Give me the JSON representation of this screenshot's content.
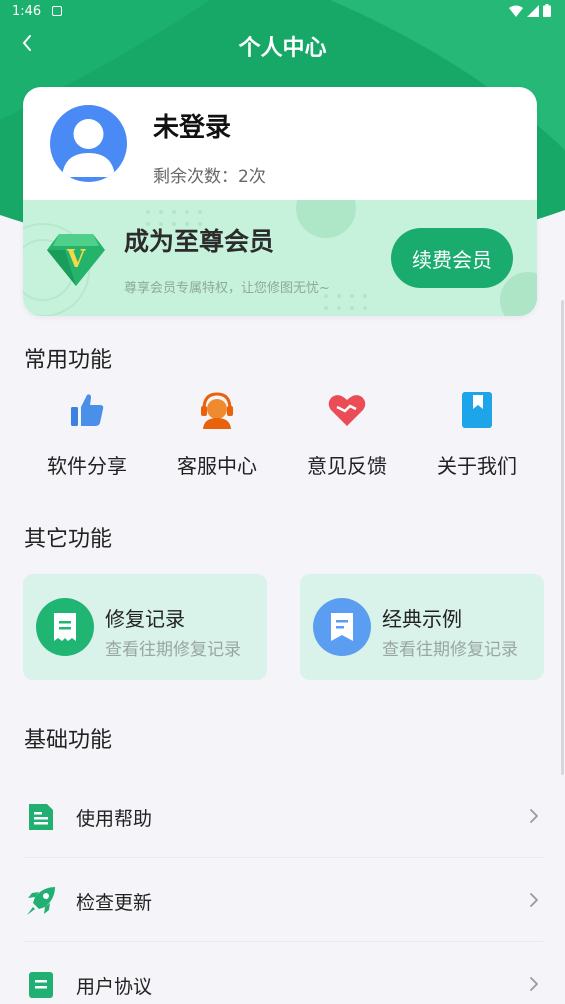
{
  "status_bar": {
    "time": "1:46"
  },
  "header": {
    "title": "个人中心"
  },
  "profile": {
    "name": "未登录",
    "remaining_label": "剩余次数：",
    "remaining_count": "2次"
  },
  "vip": {
    "title": "成为至尊会员",
    "subtitle": "尊享会员专属特权，让您修图无忧~",
    "button": "续费会员"
  },
  "sections": {
    "common": "常用功能",
    "other": "其它功能",
    "basic": "基础功能"
  },
  "common_functions": [
    {
      "label": "软件分享",
      "icon": "thumbs-up-icon"
    },
    {
      "label": "客服中心",
      "icon": "customer-service-icon"
    },
    {
      "label": "意见反馈",
      "icon": "heart-icon"
    },
    {
      "label": "关于我们",
      "icon": "book-icon"
    }
  ],
  "other_functions": [
    {
      "title": "修复记录",
      "subtitle": "查看往期修复记录",
      "icon": "receipt-icon"
    },
    {
      "title": "经典示例",
      "subtitle": "查看往期修复记录",
      "icon": "bookmark-icon"
    }
  ],
  "basic_functions": [
    {
      "label": "使用帮助",
      "icon": "help-doc-icon"
    },
    {
      "label": "检查更新",
      "icon": "rocket-icon"
    },
    {
      "label": "用户协议",
      "icon": "agreement-icon"
    }
  ],
  "colors": {
    "primary": "#1aac6f",
    "vip_band": "#c6f2dc",
    "avatar": "#4a8af4"
  }
}
